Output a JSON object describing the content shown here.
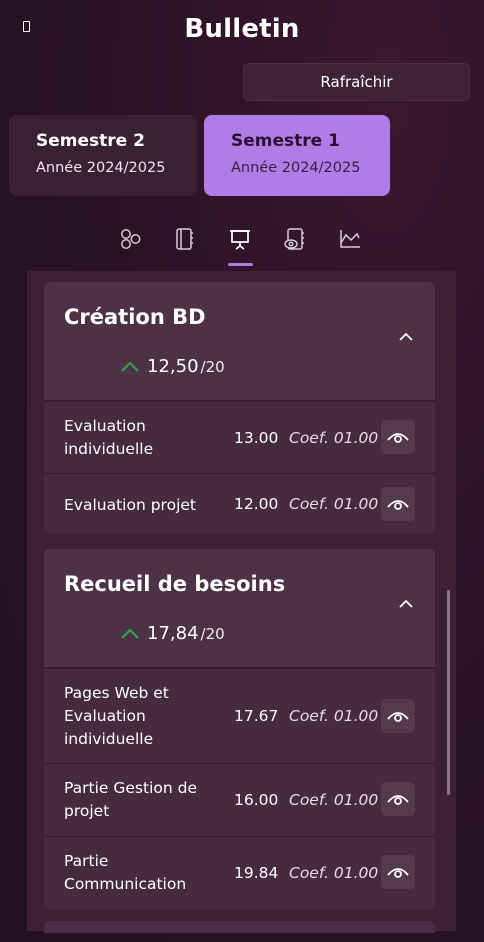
{
  "window": {
    "title": "Bulletin"
  },
  "header": {
    "refresh_label": "Rafraîchir"
  },
  "semesters": [
    {
      "title": "Semestre 2",
      "year": "Année 2024/2025",
      "selected": false
    },
    {
      "title": "Semestre 1",
      "year": "Année 2024/2025",
      "selected": true
    }
  ],
  "nav_icons": [
    "modules-icon",
    "notebook-icon",
    "presentation-icon",
    "notebook-eye-icon",
    "chart-icon"
  ],
  "active_nav": "presentation-icon",
  "accent_color": "#b27ce7",
  "trend_color": "#2fa24b",
  "modules": [
    {
      "title": "Création BD",
      "average": "12,50",
      "denominator": "/20",
      "rows": [
        {
          "name": "Evaluation individuelle",
          "grade": "13.00",
          "coef": "Coef. 01.00"
        },
        {
          "name": "Evaluation projet",
          "grade": "12.00",
          "coef": "Coef. 01.00"
        }
      ]
    },
    {
      "title": "Recueil de besoins",
      "average": "17,84",
      "denominator": "/20",
      "rows": [
        {
          "name": "Pages Web et Evaluation individuelle",
          "grade": "17.67",
          "coef": "Coef. 01.00"
        },
        {
          "name": "Partie Gestion de projet",
          "grade": "16.00",
          "coef": "Coef. 01.00"
        },
        {
          "name": "Partie Communication",
          "grade": "19.84",
          "coef": "Coef. 01.00"
        }
      ]
    }
  ]
}
